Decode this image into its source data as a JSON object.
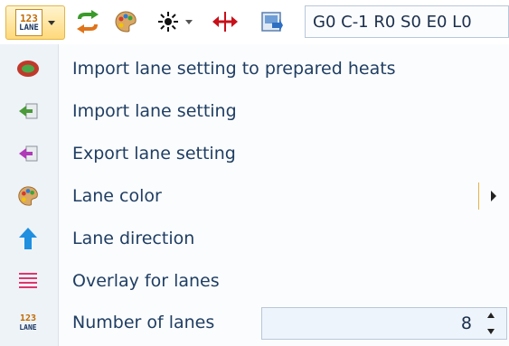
{
  "toolbar": {
    "lane_button": {
      "number": "123",
      "text": "LANE",
      "icon": "lane-count-icon"
    },
    "icons": [
      "swap-arrows-icon",
      "palette-icon",
      "sun-icon",
      "horizontal-resize-icon",
      "screen-icon"
    ],
    "status": "G0 C-1 R0 S0 E0 L0"
  },
  "menu": {
    "items": [
      {
        "label": "Import lane setting to prepared heats",
        "icon": "lane-oval-icon"
      },
      {
        "label": "Import lane setting",
        "icon": "import-icon"
      },
      {
        "label": "Export lane setting",
        "icon": "export-icon"
      },
      {
        "label": "Lane color",
        "icon": "palette-icon",
        "has_submenu": true
      },
      {
        "label": "Lane direction",
        "icon": "up-arrow-icon"
      },
      {
        "label": "Overlay for lanes",
        "icon": "lines-icon"
      },
      {
        "label": "Number of lanes",
        "icon": "lane-count-icon",
        "value": "8"
      }
    ]
  },
  "colors": {
    "accent": "#e3b54a",
    "text": "#1f3e63",
    "strip": "#eef3f8"
  }
}
